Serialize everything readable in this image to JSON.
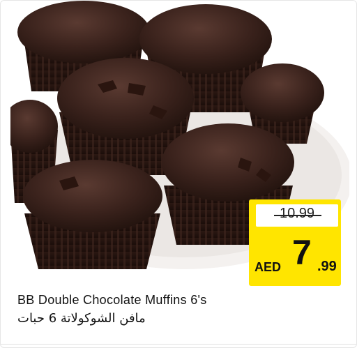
{
  "product": {
    "name_en": "BB Double Chocolate Muffins 6's",
    "name_ar": "مافن الشوكولاتة 6 حبات",
    "image": "chocolate-muffins-on-plate"
  },
  "price": {
    "old": "10.99",
    "currency": "AED",
    "integer": "7",
    "decimal": ".99"
  },
  "colors": {
    "price_tag": "#ffe500",
    "muffin": "#3a211b",
    "plate": "#f4f1ef"
  }
}
